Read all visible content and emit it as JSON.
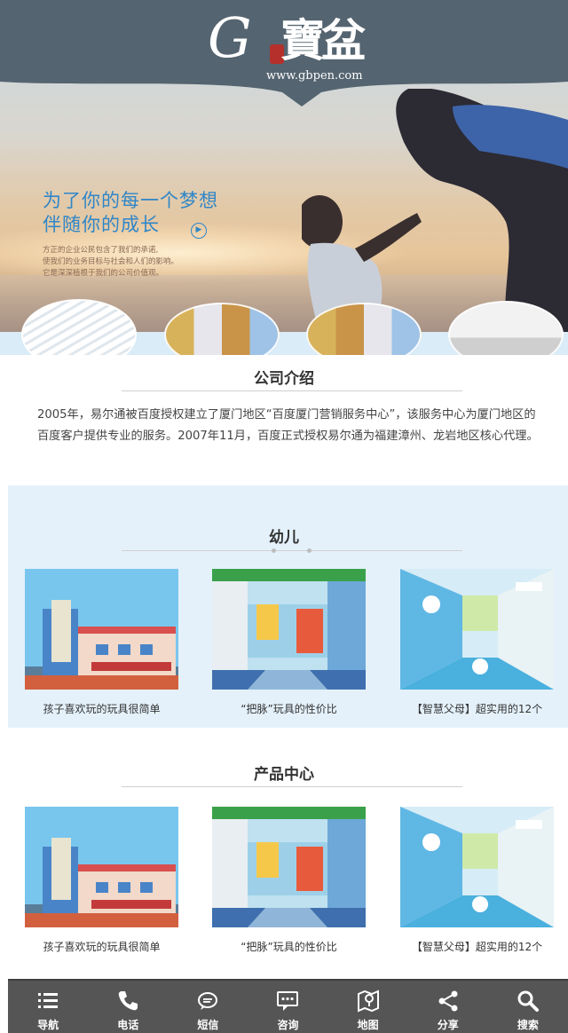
{
  "header": {
    "logo_letter": "G",
    "logo_chinese": "寶盆",
    "logo_url": "www.gbpen.com"
  },
  "banner": {
    "slogan_line1": "为了你的每一个梦想",
    "slogan_line2": "伴随你的成长",
    "small_line1": "方正的企业公民包含了我们的承诺,",
    "small_line2": "使我们的业务目标与社会和人们的影响。",
    "small_line3": "它是深深植根于我们的公司价值观。"
  },
  "intro": {
    "title": "公司介绍",
    "text": "2005年，易尔通被百度授权建立了厦门地区“百度厦门营销服务中心”，该服务中心为厦门地区的百度客户提供专业的服务。2007年11月，百度正式授权易尔通为福建漳州、龙岩地区核心代理。"
  },
  "section_youer": {
    "title": "幼儿",
    "cards": [
      {
        "caption": "孩子喜欢玩的玩具很简单"
      },
      {
        "caption": "“把脉”玩具的性价比"
      },
      {
        "caption": "【智慧父母】超实用的12个"
      }
    ]
  },
  "section_products": {
    "title": "产品中心",
    "cards": [
      {
        "caption": "孩子喜欢玩的玩具很简单"
      },
      {
        "caption": "“把脉”玩具的性价比"
      },
      {
        "caption": "【智慧父母】超实用的12个"
      }
    ]
  },
  "footer_nav": [
    {
      "label": "导航",
      "icon": "menu-icon"
    },
    {
      "label": "电话",
      "icon": "phone-icon"
    },
    {
      "label": "短信",
      "icon": "sms-icon"
    },
    {
      "label": "咨询",
      "icon": "chat-icon"
    },
    {
      "label": "地图",
      "icon": "map-icon"
    },
    {
      "label": "分享",
      "icon": "share-icon"
    },
    {
      "label": "搜索",
      "icon": "search-icon"
    }
  ],
  "colors": {
    "header_band": "#546470",
    "slogan_blue": "#2f86c8",
    "panel_blue": "#e4f1fb",
    "footer_bg": "#555555"
  }
}
